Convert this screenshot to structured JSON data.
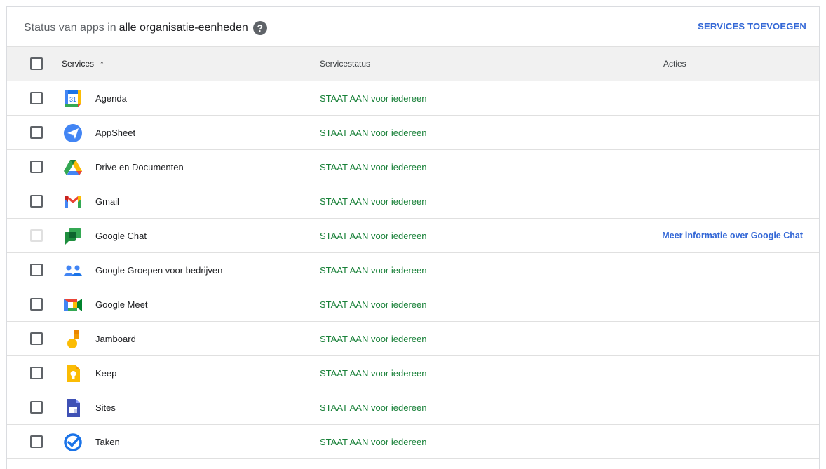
{
  "header": {
    "title_prefix": "Status van apps in",
    "title_bold": "alle organisatie-eenheden",
    "help_glyph": "?",
    "add_services_label": "SERVICES TOEVOEGEN"
  },
  "table": {
    "columns": {
      "services": "Services",
      "sort_glyph": "↑",
      "status": "Servicestatus",
      "actions": "Acties"
    },
    "rows": [
      {
        "name": "Agenda",
        "status": "STAAT AAN voor iedereen",
        "action": "",
        "icon": "calendar-icon"
      },
      {
        "name": "AppSheet",
        "status": "STAAT AAN voor iedereen",
        "action": "",
        "icon": "appsheet-icon"
      },
      {
        "name": "Drive en Documenten",
        "status": "STAAT AAN voor iedereen",
        "action": "",
        "icon": "drive-icon"
      },
      {
        "name": "Gmail",
        "status": "STAAT AAN voor iedereen",
        "action": "",
        "icon": "gmail-icon"
      },
      {
        "name": "Google Chat",
        "status": "STAAT AAN voor iedereen",
        "action": "Meer informatie over Google Chat",
        "icon": "chat-icon"
      },
      {
        "name": "Google Groepen voor bedrijven",
        "status": "STAAT AAN voor iedereen",
        "action": "",
        "icon": "groups-icon"
      },
      {
        "name": "Google Meet",
        "status": "STAAT AAN voor iedereen",
        "action": "",
        "icon": "meet-icon"
      },
      {
        "name": "Jamboard",
        "status": "STAAT AAN voor iedereen",
        "action": "",
        "icon": "jamboard-icon"
      },
      {
        "name": "Keep",
        "status": "STAAT AAN voor iedereen",
        "action": "",
        "icon": "keep-icon"
      },
      {
        "name": "Sites",
        "status": "STAAT AAN voor iedereen",
        "action": "",
        "icon": "sites-icon"
      },
      {
        "name": "Taken",
        "status": "STAAT AAN voor iedereen",
        "action": "",
        "icon": "tasks-icon"
      }
    ]
  },
  "colors": {
    "status_green": "#188038",
    "link_blue": "#3367d6",
    "header_bg": "#f1f1f1"
  }
}
